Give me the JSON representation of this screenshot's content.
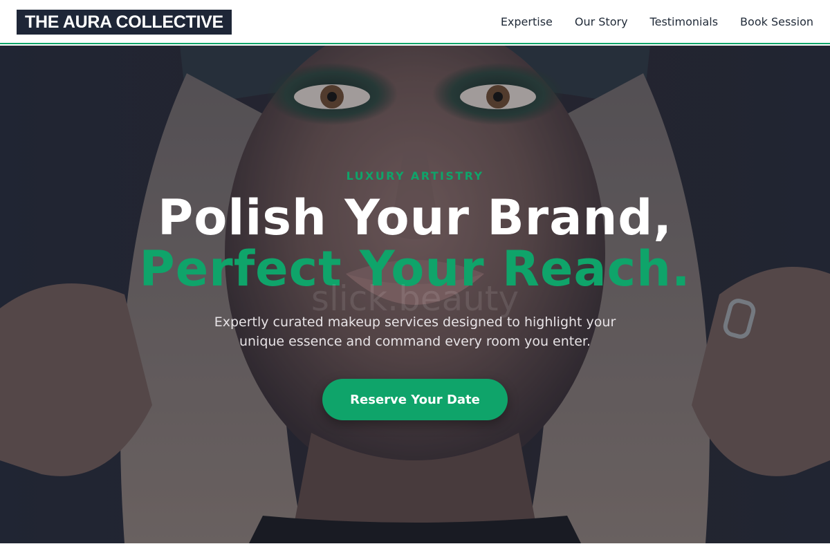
{
  "brand": {
    "name": "THE AURA COLLECTIVE"
  },
  "nav": {
    "items": [
      {
        "label": "Expertise"
      },
      {
        "label": "Our Story"
      },
      {
        "label": "Testimonials"
      },
      {
        "label": "Book Session"
      }
    ]
  },
  "hero": {
    "eyebrow": "LUXURY ARTISTRY",
    "headline_line1": "Polish Your Brand,",
    "headline_line2": "Perfect Your Reach.",
    "watermark": "slick.beauty",
    "subtext": "Expertly curated makeup services designed to highlight your unique essence and command every room you enter.",
    "cta_label": "Reserve Your Date",
    "background_image": "portrait-photo"
  },
  "colors": {
    "accent": "#0fa46a",
    "logo_bg": "#1e2637",
    "nav_text": "#1f2937"
  }
}
